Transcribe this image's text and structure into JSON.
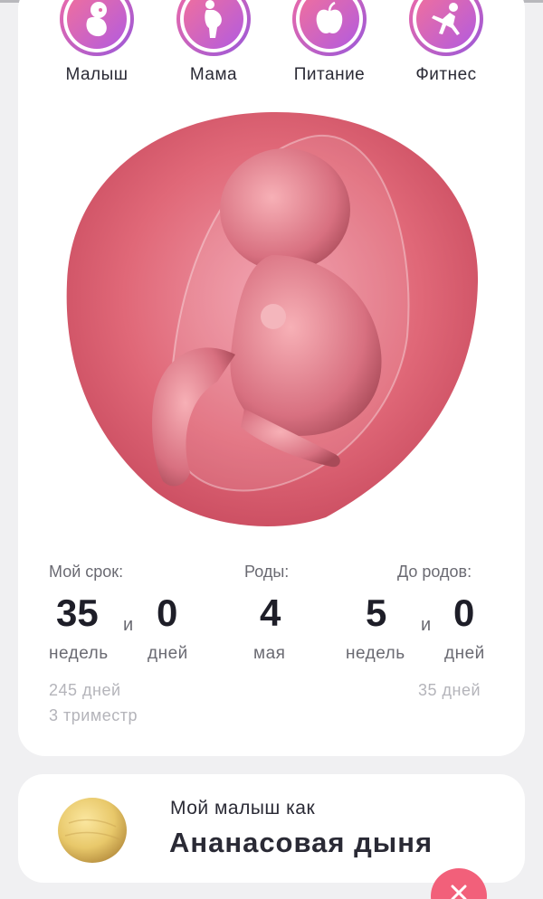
{
  "categories": [
    {
      "label": "Малыш",
      "icon": "baby-icon"
    },
    {
      "label": "Мама",
      "icon": "pregnant-mother-icon"
    },
    {
      "label": "Питание",
      "icon": "apple-icon"
    },
    {
      "label": "Фитнес",
      "icon": "fitness-icon"
    }
  ],
  "illustration": {
    "icon": "fetus-illustration"
  },
  "stats": {
    "term": {
      "title": "Мой срок:",
      "weeks": "35",
      "and": "и",
      "days": "0",
      "weeks_unit": "недель",
      "days_unit": "дней",
      "total_days": "245 дней",
      "trimester": "3 триместр"
    },
    "birth": {
      "title": "Роды:",
      "day": "4",
      "month": "мая"
    },
    "remaining": {
      "title": "До родов:",
      "weeks": "5",
      "and": "и",
      "days": "0",
      "weeks_unit": "недель",
      "days_unit": "дней",
      "total_days": "35 дней"
    }
  },
  "fruit": {
    "subtitle": "Мой малыш как",
    "name": "Ананасовая дыня",
    "icon": "melon-icon"
  },
  "close_button": {
    "icon": "close-icon"
  },
  "colors": {
    "accent_pink": "#f06aa6",
    "accent_purple": "#9b59d9",
    "close_button": "#f2607a"
  }
}
